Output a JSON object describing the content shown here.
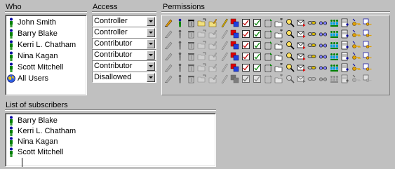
{
  "headers": {
    "who": "Who",
    "access": "Access",
    "permissions": "Permissions",
    "subscribers": "List of subscribers"
  },
  "who": [
    {
      "name": "John Smith",
      "icon": "person-icon"
    },
    {
      "name": "Barry Blake",
      "icon": "person-icon"
    },
    {
      "name": "Kerri L. Chatham",
      "icon": "person-icon"
    },
    {
      "name": "Nina Kagan",
      "icon": "person-icon"
    },
    {
      "name": "Scott Mitchell",
      "icon": "person-icon"
    },
    {
      "name": "All Users",
      "icon": "globe-icon"
    }
  ],
  "access": [
    "Controller",
    "Controller",
    "Contributor",
    "Contributor",
    "Contributor",
    "Disallowed"
  ],
  "permission_icons": [
    "pencil-edit",
    "person",
    "trash",
    "folder-open",
    "folder-edit",
    "pencil",
    "square",
    "rename",
    "checkbox",
    "trash-recycle",
    "folder-new",
    "magnifier",
    "mail",
    "link",
    "glasses",
    "people",
    "document-user",
    "key-new",
    "key-copy"
  ],
  "permission_states": [
    "1111111111111111111",
    "0000001111111111111",
    "0000001111111111111",
    "0000001111111111111",
    "0000001111111111111",
    "0000000000000000000"
  ],
  "subscribers": [
    "Barry Blake",
    "Kerri L. Chatham",
    "Nina Kagan",
    "Scott Mitchell"
  ],
  "colors": {
    "background": "#c0c0c0",
    "person_green": "#008000",
    "person_blue": "#0000a0"
  }
}
